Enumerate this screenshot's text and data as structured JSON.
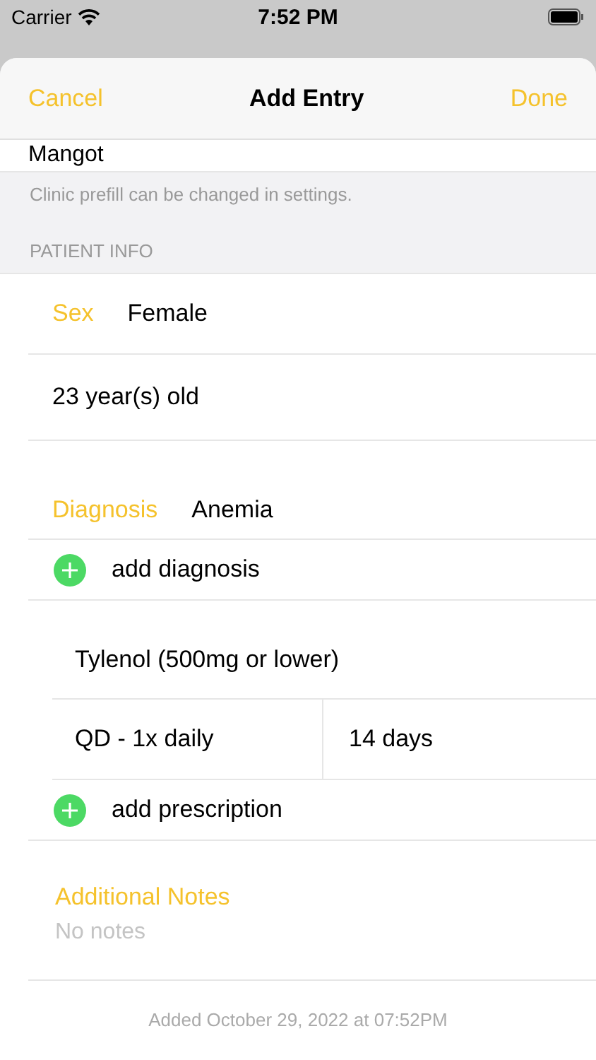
{
  "status_bar": {
    "carrier": "Carrier",
    "time": "7:52 PM"
  },
  "nav": {
    "cancel": "Cancel",
    "title": "Add Entry",
    "done": "Done"
  },
  "clinic": {
    "value": "Mangot",
    "footer": "Clinic prefill can be changed in settings."
  },
  "patient_info": {
    "header": "PATIENT INFO",
    "sex_label": "Sex",
    "sex_value": "Female",
    "age": "23 year(s) old"
  },
  "diagnosis": {
    "label": "Diagnosis",
    "value": "Anemia",
    "add": "add diagnosis"
  },
  "prescription": {
    "drug": "Tylenol (500mg or lower)",
    "frequency": "QD - 1x daily",
    "duration": "14 days",
    "add": "add prescription"
  },
  "notes": {
    "label": "Additional Notes",
    "placeholder": "No notes"
  },
  "added": "Added October 29, 2022 at 07:52PM"
}
